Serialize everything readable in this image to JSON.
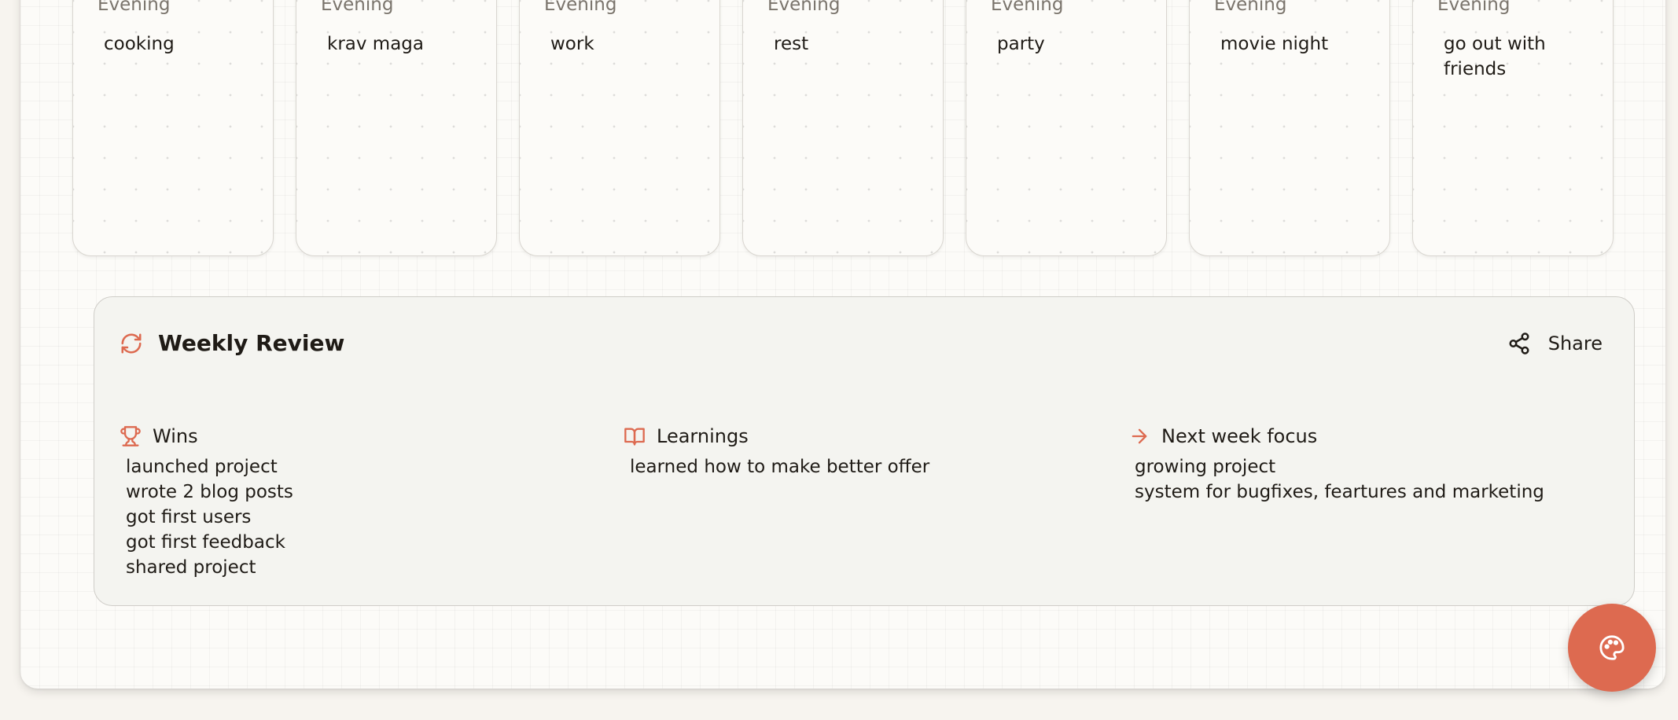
{
  "days": [
    {
      "slot": "Evening",
      "text": "cooking"
    },
    {
      "slot": "Evening",
      "text": "krav maga"
    },
    {
      "slot": "Evening",
      "text": "work"
    },
    {
      "slot": "Evening",
      "text": "rest"
    },
    {
      "slot": "Evening",
      "text": "party"
    },
    {
      "slot": "Evening",
      "text": "movie night"
    },
    {
      "slot": "Evening",
      "text": "go out with friends"
    }
  ],
  "review": {
    "title": "Weekly Review",
    "title_icon": "refresh-icon",
    "share_label": "Share",
    "share_icon": "share-icon",
    "columns": [
      {
        "title": "Wins",
        "icon": "trophy-icon",
        "items": [
          "launched project",
          "wrote 2 blog posts",
          "got first users",
          "got first feedback",
          "shared project"
        ]
      },
      {
        "title": "Learnings",
        "icon": "book-icon",
        "items": [
          "learned how to make better offer"
        ]
      },
      {
        "title": "Next week focus",
        "icon": "arrow-right-icon",
        "items": [
          "growing project",
          "system for bugfixes, feartures and marketing"
        ]
      }
    ]
  },
  "fab": {
    "icon": "palette-icon"
  },
  "colors": {
    "accent": "#dd6a50",
    "text": "#1f1b16",
    "muted": "#7a746c",
    "panel": "#f4f4f0"
  }
}
